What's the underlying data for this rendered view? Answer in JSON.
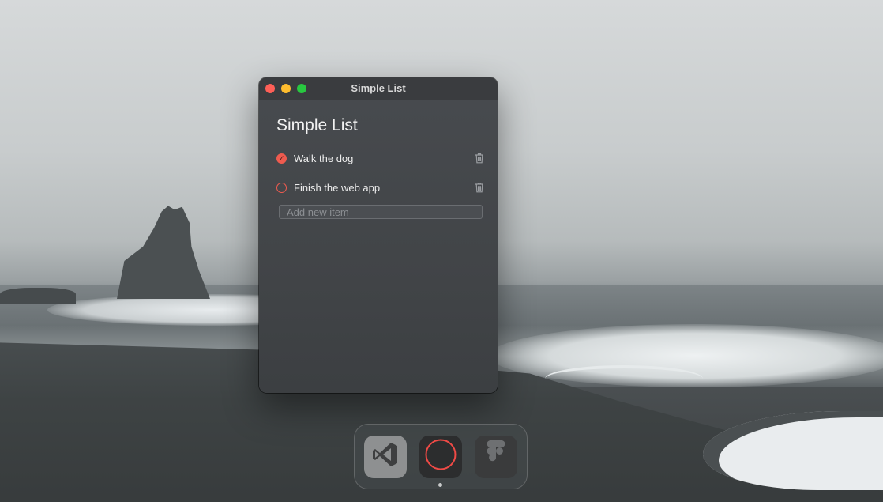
{
  "window": {
    "title": "Simple List",
    "controls": [
      "close",
      "minimize",
      "zoom"
    ]
  },
  "app": {
    "heading": "Simple List",
    "items": [
      {
        "label": "Walk the dog",
        "completed": true
      },
      {
        "label": "Finish the web app",
        "completed": false
      }
    ],
    "new_item": {
      "placeholder": "Add new item",
      "value": ""
    }
  },
  "dock": {
    "apps": [
      {
        "name": "Visual Studio Code",
        "icon": "vscode-icon"
      },
      {
        "name": "Simple List",
        "icon": "red-circle-icon",
        "running": true
      },
      {
        "name": "Figma",
        "icon": "figma-icon"
      }
    ]
  },
  "colors": {
    "accent": "#ef5b4f",
    "window_bg": "#414447"
  }
}
